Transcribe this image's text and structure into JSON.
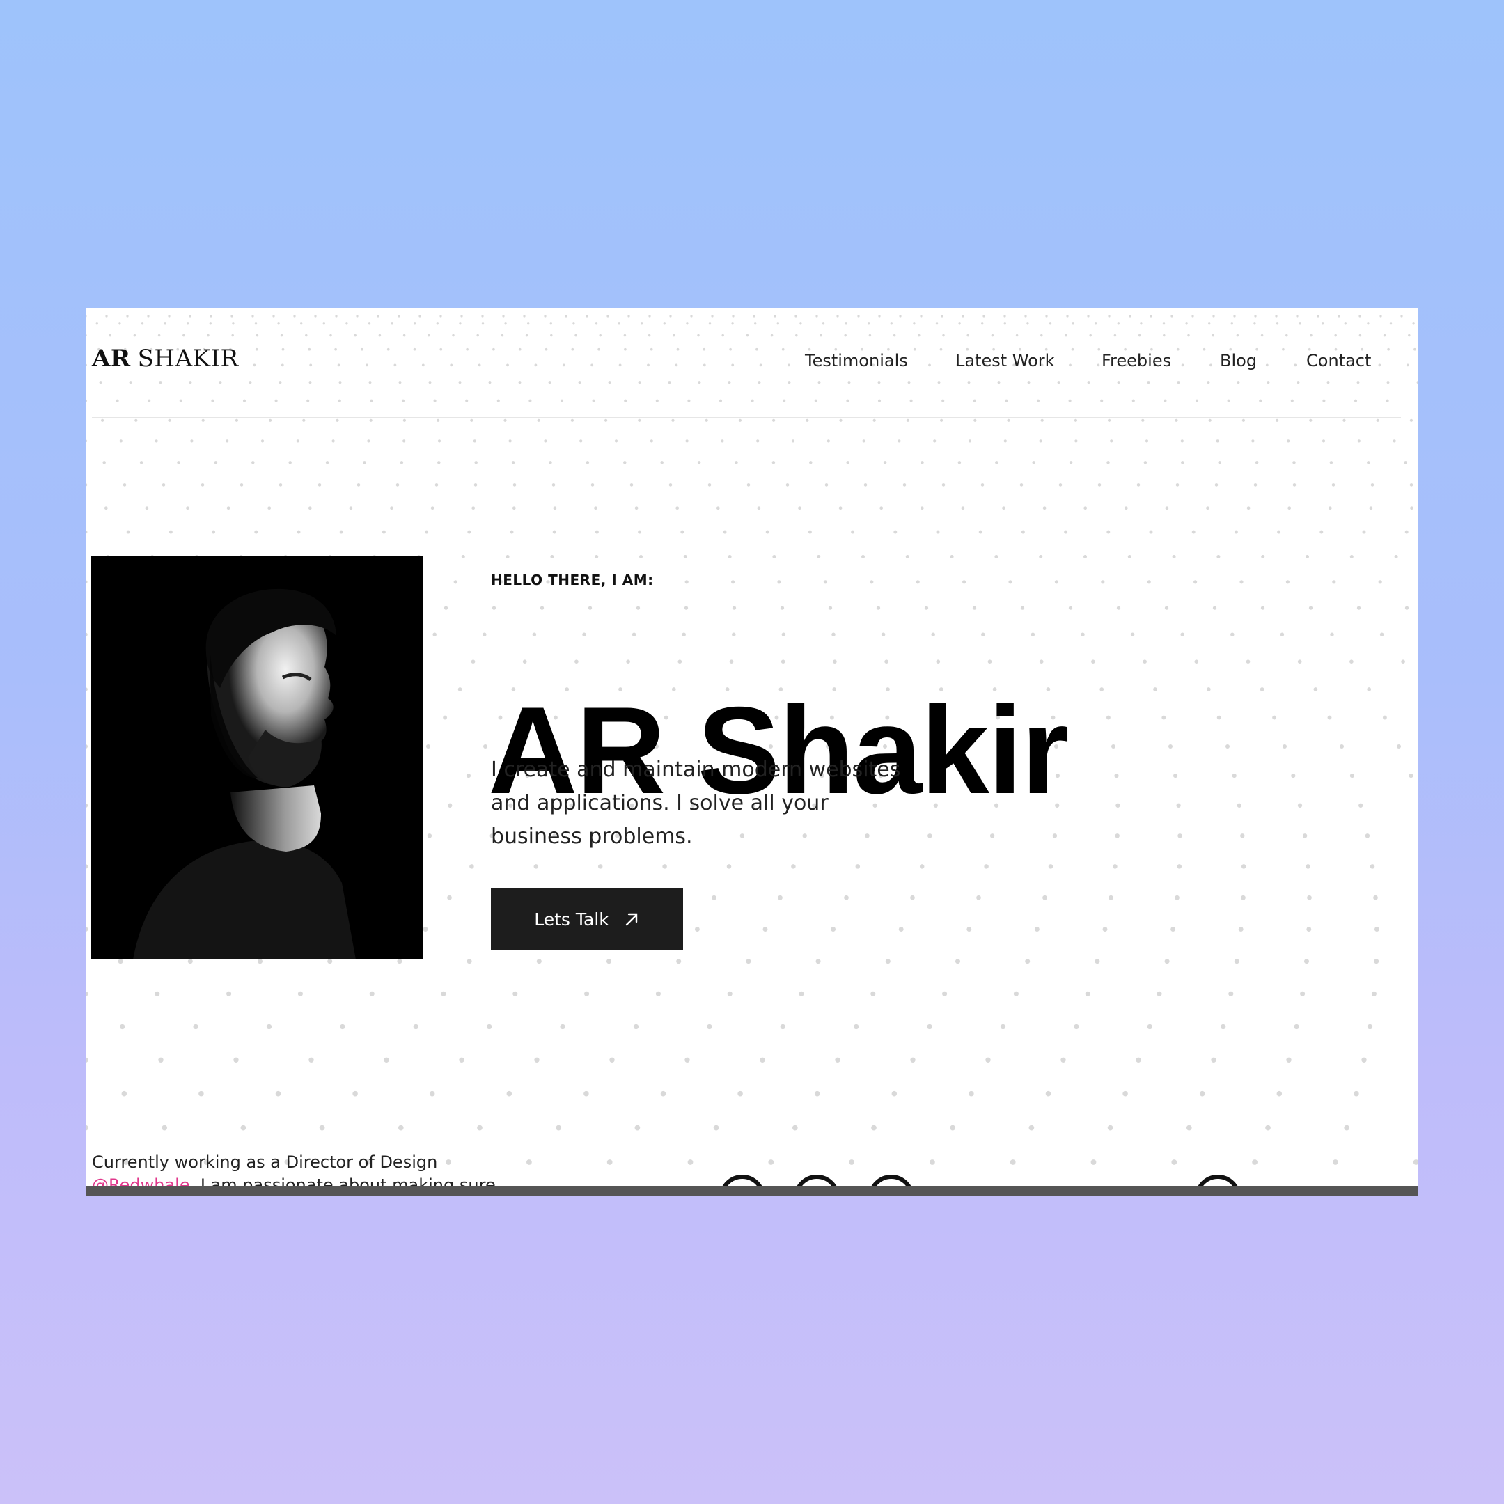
{
  "header": {
    "logo_bold": "AR",
    "logo_light": "SHAKIR",
    "nav": [
      {
        "label": "Testimonials"
      },
      {
        "label": "Latest Work"
      },
      {
        "label": "Freebies"
      },
      {
        "label": "Blog"
      },
      {
        "label": "Contact"
      }
    ]
  },
  "hero": {
    "greeting": "HELLO THERE, I AM:",
    "name": "AR Shakir",
    "description_lines": [
      "I create and maintain modern websites",
      "and applications. I solve all your",
      "business problems."
    ],
    "cta_label": "Lets Talk",
    "cta_icon": "arrow-up-right-icon",
    "portrait_alt": "black-and-white portrait"
  },
  "about": {
    "line1": "Currently working as a Director of Design",
    "line2_link": "@Redwhale",
    "line2_rest": ". I am passionate about making sure"
  },
  "colors": {
    "background_top": "#9ec3fb",
    "background_bottom": "#cbc1f9",
    "button_bg": "#1d1d1d",
    "link": "#e0378b"
  }
}
